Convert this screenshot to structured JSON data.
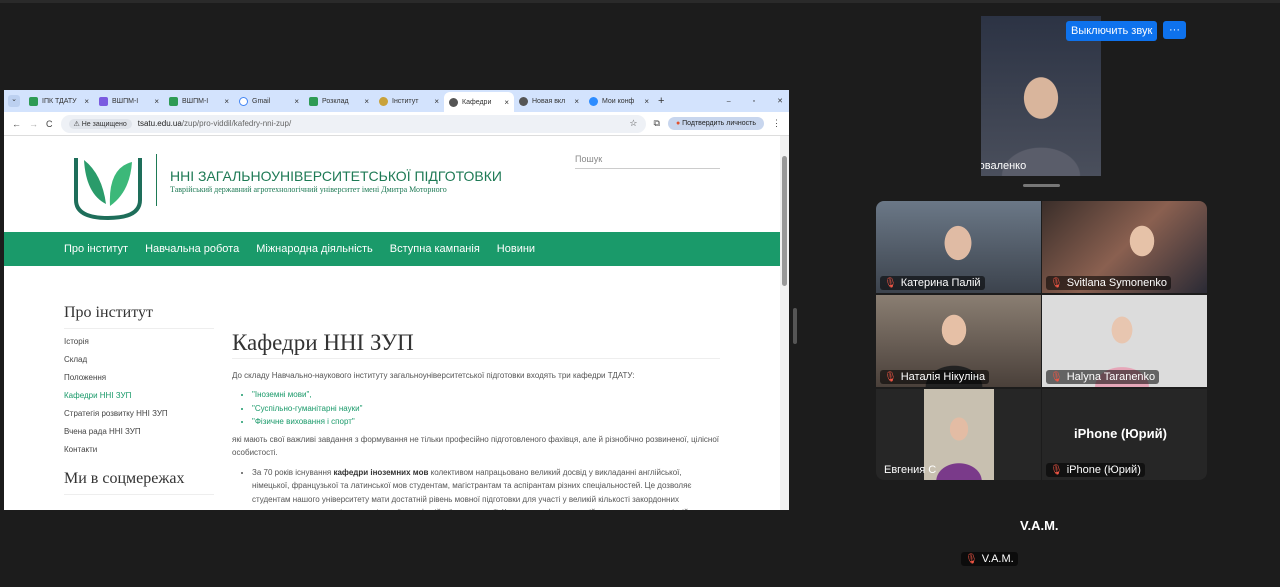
{
  "browser": {
    "tabs": [
      {
        "label": "ІПК ТДАТУ"
      },
      {
        "label": "ВШПМ-I"
      },
      {
        "label": "ВШПМ-I"
      },
      {
        "label": "Gmail"
      },
      {
        "label": "Розклад"
      },
      {
        "label": "Інститут"
      },
      {
        "label": "Кафедри"
      },
      {
        "label": "Новая вкл"
      },
      {
        "label": "Мои конф"
      }
    ],
    "security": "Не защищено",
    "url_host": "tsatu.edu.ua",
    "url_path": "/zup/pro-viddil/kafedry-nni-zup/",
    "verify": "Подтвердить личность"
  },
  "site": {
    "title": "ННІ ЗАГАЛЬНОУНІВЕРСИТЕТСЬКОЇ ПІДГОТОВКИ",
    "subtitle": "Таврійський державний агротехнологічний університет імені Дмитра Моторного",
    "search_placeholder": "Пошук",
    "nav": [
      "Про інститут",
      "Навчальна робота",
      "Міжнародна діяльність",
      "Вступна кампанія",
      "Новини"
    ],
    "sidebar_title": "Про інститут",
    "sidebar": [
      "Історія",
      "Склад",
      "Положення",
      "Кафедри ННІ ЗУП",
      "Стратегія розвитку ННІ ЗУП",
      "Вчена рада ННІ ЗУП",
      "Контакти"
    ],
    "sidebar_title2": "Ми в соцмережах",
    "heading": "Кафедри ННІ ЗУП",
    "intro": "До складу Навчально-наукового інституту загальноуніверситетської підготовки входять три кафедри ТДАТУ:",
    "links": [
      "\"Іноземні мови\",",
      "\"Суспільно-гуманітарні науки\"",
      "\"Фізичне виховання і спорт\""
    ],
    "para2": "які мають свої важливі завдання з формування не тільки професійно підготовленого фахівця, але й різнобічно розвиненої, цілісної особистості.",
    "bullet_pre": "За 70 років існування ",
    "bullet_bold": "кафедри іноземних мов",
    "bullet_rest": " колективом напрацьовано великий досвід у викладанні англійської, німецької, французької та латинської мов студентам, магістрантам та аспірантам різних спеціальностей. Це дозволяє студентам нашого університету мати достатній рівень мовної підготовки для участі у великій кількості закордонних стажувань, що значно підвищує рівень їх професійної компетенції. Колектив кафедри постійно впроваджує в освітній процес нові науково-методичні розробки, інноваційні методи навчання та інформаційні технології. І тому влевнено виборює високі місця у рейтингу кафедр університету, зокрема з організаційної, міжнародної та навчальної роботи."
  },
  "meeting": {
    "unmute": "Выключить звук",
    "more": "···",
    "speaker": "Анастасія Коноваленко",
    "participants": [
      "Катерина Палій",
      "Svitlana Symonenko",
      "Наталія Нікуліна",
      "Halyna Taranenko",
      "Евгения С",
      "iPhone (Юрий)"
    ],
    "iphone_big": "iPhone (Юрий)",
    "vam_big": "V.A.M.",
    "vam": "V.A.M."
  }
}
